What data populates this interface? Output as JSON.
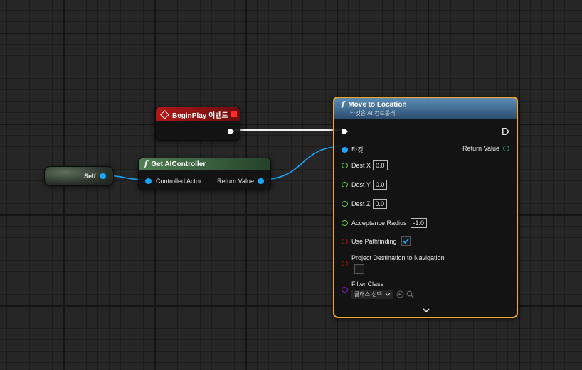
{
  "begin_play": {
    "title": "BeginPlay 이벤트"
  },
  "self_node": {
    "label": "Self"
  },
  "get_ai_controller": {
    "title": "Get AIController",
    "input_label": "Controlled Actor",
    "output_label": "Return Value"
  },
  "move_to_location": {
    "title": "Move to Location",
    "subtitle": "타깃은 AI 컨트롤러",
    "target_label": "타깃",
    "return_label": "Return Value",
    "dest_x_label": "Dest X",
    "dest_x_value": "0.0",
    "dest_y_label": "Dest Y",
    "dest_y_value": "0.0",
    "dest_z_label": "Dest Z",
    "dest_z_value": "0.0",
    "acceptance_label": "Acceptance Radius",
    "acceptance_value": "-1.0",
    "use_pathfinding_label": "Use Pathfinding",
    "use_pathfinding_checked": true,
    "project_destination_label": "Project Destination to Navigation",
    "project_destination_checked": false,
    "filter_class_label": "Filter Class",
    "filter_class_value": "클래스 선택"
  },
  "colors": {
    "exec_wire": "#ffffff",
    "object_wire": "#1aa7ff",
    "event_header": "#8c1010",
    "function_header": "#2e6f98",
    "selection_outline": "#f5a623"
  }
}
